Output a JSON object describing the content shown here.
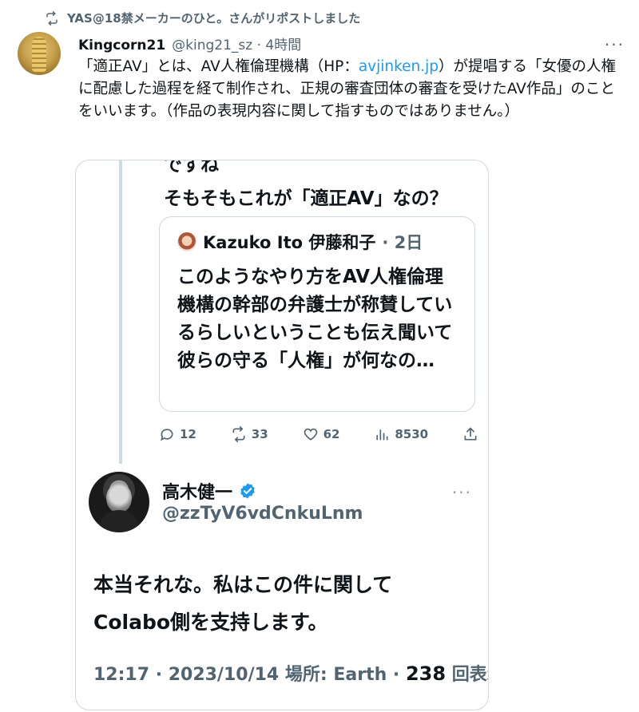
{
  "repost": {
    "text": "YAS@18禁メーカーのひと。さんがリポストしました",
    "icon": "repost-icon"
  },
  "main_tweet": {
    "author_name": "Kingcorn21",
    "author_handle_time": "@king21_sz · 4時間",
    "more_label": "···",
    "text_before_link": "「適正AV」とは、AV人権倫理機構（HP：",
    "link_text": "avjinken.jp",
    "text_after_link": "）が提唱する「女優の人権に配慮した過程を経て制作され、正規の審査団体の審査を受けたAV作品」のことをいいます。（作品の表現内容に関して指すものではありません。）"
  },
  "screenshot_card": {
    "cut_text": "ですね",
    "question": "そもそもこれが「適正AV」なの？",
    "inner_quote": {
      "author": "Kazuko Ito 伊藤和子",
      "time": "· 2日",
      "body": "このようなやり方をAV人権倫理機構の幹部の弁護士が称賛しているらしいということも伝え聞いて彼らの守る「人権」が何なの…"
    },
    "actions": {
      "replies": "12",
      "reposts": "33",
      "likes": "62",
      "views": "8530"
    },
    "reply": {
      "author_name": "高木健一",
      "author_handle": "@zzTyV6vdCnkuLnm",
      "more_label": "···",
      "body_line1": "本当それな。私はこの件に関して",
      "body_line2": "Colabo側を支持します。",
      "meta_prefix": "12:17 · 2023/10/14 場所: Earth · ",
      "meta_views_number": "238",
      "meta_views_label": " 回表示"
    }
  },
  "colors": {
    "link": "#1d9bf0",
    "secondary_text": "#536471",
    "verified": "#1d9bf0",
    "border": "#cfd9de"
  }
}
